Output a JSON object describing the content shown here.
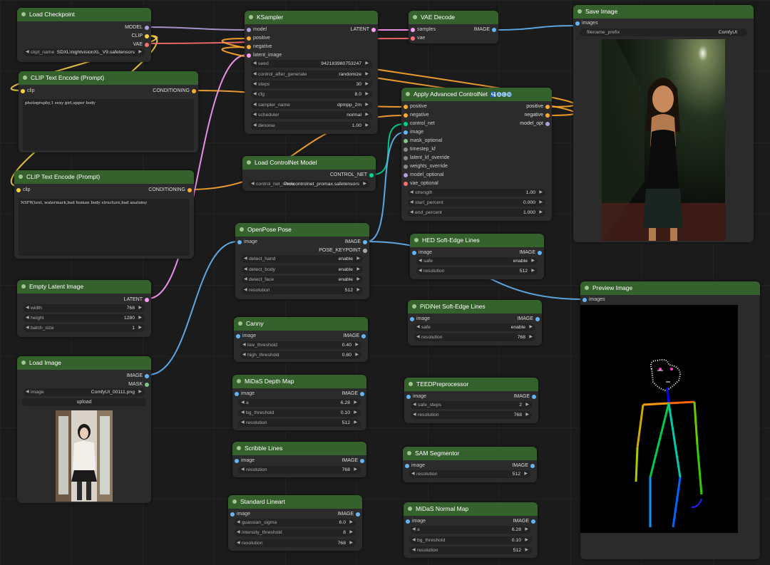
{
  "colors": {
    "model": "#b39ddb",
    "clip": "#f5d142",
    "vae": "#ff6e6e",
    "conditioning": "#ffa931",
    "latent": "#ff9cf9",
    "image": "#64b5f6",
    "control_net": "#00d78d",
    "mask": "#81c784",
    "pose": "#aaaaaa",
    "generic": "#888888"
  },
  "nodes": {
    "load_checkpoint": {
      "title": "Load Checkpoint",
      "outputs": [
        "MODEL",
        "CLIP",
        "VAE"
      ],
      "ckpt_label": "ckpt_name",
      "ckpt_value": "SDXL\\nightvisionXL_V9.safetensors"
    },
    "clip_pos": {
      "title": "CLIP Text Encode (Prompt)",
      "input": "clip",
      "output": "CONDITIONING",
      "text": "photography,1 sexy girl,upper body"
    },
    "clip_neg": {
      "title": "CLIP Text Encode (Prompt)",
      "input": "clip",
      "output": "CONDITIONING",
      "text": "NSFW,text, watermark,bad human body structure,bad anatomy"
    },
    "empty_latent": {
      "title": "Empty Latent Image",
      "output": "LATENT",
      "widgets": [
        {
          "label": "width",
          "value": "768"
        },
        {
          "label": "height",
          "value": "1280"
        },
        {
          "label": "batch_size",
          "value": "1"
        }
      ]
    },
    "load_image": {
      "title": "Load Image",
      "outputs": [
        "IMAGE",
        "MASK"
      ],
      "image_label": "image",
      "image_value": "ComfyUI_00111.png",
      "upload": "upload"
    },
    "ksampler": {
      "title": "KSampler",
      "inputs": [
        "model",
        "positive",
        "negative",
        "latent_image"
      ],
      "output": "LATENT",
      "widgets": [
        {
          "label": "seed",
          "value": "942183980753247"
        },
        {
          "label": "control_after_generate",
          "value": "randomize"
        },
        {
          "label": "steps",
          "value": "30"
        },
        {
          "label": "cfg",
          "value": "8.0"
        },
        {
          "label": "sampler_name",
          "value": "dpmpp_2m"
        },
        {
          "label": "scheduler",
          "value": "normal"
        },
        {
          "label": "denoise",
          "value": "1.00"
        }
      ]
    },
    "vae_decode": {
      "title": "VAE Decode",
      "inputs": [
        "samples",
        "vae"
      ],
      "output": "IMAGE"
    },
    "save_image": {
      "title": "Save Image",
      "input": "images",
      "prefix_label": "filename_prefix",
      "prefix_value": "ComfyUI"
    },
    "apply_cn": {
      "title": "Apply Advanced ControlNet",
      "badge": "🛂🅐🅒🅝",
      "inputs": [
        "positive",
        "negative",
        "control_net",
        "image",
        "mask_optional",
        "timestep_kf",
        "latent_kf_override",
        "weights_override",
        "model_optional",
        "vae_optional"
      ],
      "outputs": [
        "positive",
        "negative",
        "model_opt"
      ],
      "widgets": [
        {
          "label": "strength",
          "value": "1.00"
        },
        {
          "label": "start_percent",
          "value": "0.000"
        },
        {
          "label": "end_percent",
          "value": "1.000"
        }
      ]
    },
    "load_cn": {
      "title": "Load ControlNet Model",
      "output": "CONTROL_NET",
      "widget_label": "control_net_name",
      "widget_value": "Pro\\controlnet_promax.safetensors"
    },
    "openpose": {
      "title": "OpenPose Pose",
      "input": "image",
      "outputs": [
        "IMAGE",
        "POSE_KEYPOINT"
      ],
      "widgets": [
        {
          "label": "detect_hand",
          "value": "enable"
        },
        {
          "label": "detect_body",
          "value": "enable"
        },
        {
          "label": "detect_face",
          "value": "enable"
        },
        {
          "label": "resolution",
          "value": "512"
        }
      ]
    },
    "canny": {
      "title": "Canny",
      "input": "image",
      "output": "IMAGE",
      "widgets": [
        {
          "label": "low_threshold",
          "value": "0.40"
        },
        {
          "label": "high_threshold",
          "value": "0.80"
        }
      ]
    },
    "midas_depth": {
      "title": "MiDaS Depth Map",
      "input": "image",
      "output": "IMAGE",
      "widgets": [
        {
          "label": "a",
          "value": "6.28"
        },
        {
          "label": "bg_threshold",
          "value": "0.10"
        },
        {
          "label": "resolution",
          "value": "512"
        }
      ]
    },
    "scribble": {
      "title": "Scribble Lines",
      "input": "image",
      "output": "IMAGE",
      "widgets": [
        {
          "label": "resolution",
          "value": "768"
        }
      ]
    },
    "lineart": {
      "title": "Standard Lineart",
      "input": "image",
      "output": "IMAGE",
      "widgets": [
        {
          "label": "guassian_sigma",
          "value": "6.0"
        },
        {
          "label": "intensity_threshold",
          "value": "8"
        },
        {
          "label": "resolution",
          "value": "768"
        }
      ]
    },
    "hed": {
      "title": "HED Soft-Edge Lines",
      "input": "image",
      "output": "IMAGE",
      "widgets": [
        {
          "label": "safe",
          "value": "enable"
        },
        {
          "label": "resolution",
          "value": "512"
        }
      ]
    },
    "pidinet": {
      "title": "PiDiNet Soft-Edge Lines",
      "input": "image",
      "output": "IMAGE",
      "widgets": [
        {
          "label": "safe",
          "value": "enable"
        },
        {
          "label": "resolution",
          "value": "768"
        }
      ]
    },
    "teed": {
      "title": "TEEDPreprocessor",
      "input": "image",
      "output": "IMAGE",
      "widgets": [
        {
          "label": "safe_steps",
          "value": "2"
        },
        {
          "label": "resolution",
          "value": "768"
        }
      ]
    },
    "sam": {
      "title": "SAM Segmentor",
      "input": "image",
      "output": "IMAGE",
      "widgets": [
        {
          "label": "resolution",
          "value": "512"
        }
      ]
    },
    "midas_normal": {
      "title": "MiDaS Normal Map",
      "input": "image",
      "output": "IMAGE",
      "widgets": [
        {
          "label": "a",
          "value": "6.28"
        },
        {
          "label": "bg_threshold",
          "value": "0.10"
        },
        {
          "label": "resolution",
          "value": "512"
        }
      ]
    },
    "preview": {
      "title": "Preview Image",
      "input": "images"
    }
  }
}
